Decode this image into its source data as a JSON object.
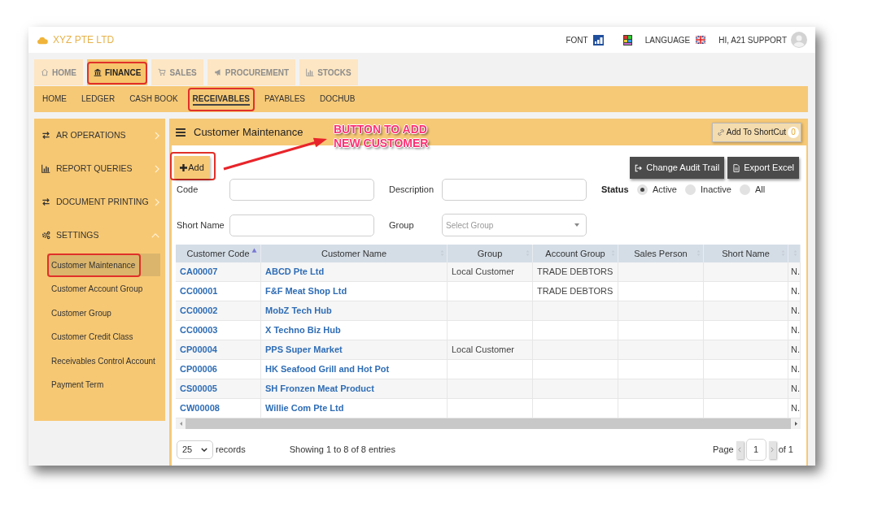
{
  "header": {
    "company": "XYZ PTE LTD",
    "font_label": "FONT",
    "language_label": "LANGUAGE",
    "greeting": "HI, A21 SUPPORT"
  },
  "main_tabs": [
    {
      "label": "HOME",
      "selected": false,
      "highlighted": false
    },
    {
      "label": "FINANCE",
      "selected": true,
      "highlighted": true
    },
    {
      "label": "SALES",
      "selected": false,
      "highlighted": false
    },
    {
      "label": "PROCUREMENT",
      "selected": false,
      "highlighted": false
    },
    {
      "label": "STOCKS",
      "selected": false,
      "highlighted": false
    }
  ],
  "sub_nav": [
    {
      "label": "HOME",
      "selected": false,
      "highlighted": false
    },
    {
      "label": "LEDGER",
      "selected": false,
      "highlighted": false
    },
    {
      "label": "CASH BOOK",
      "selected": false,
      "highlighted": false
    },
    {
      "label": "RECEIVABLES",
      "selected": true,
      "highlighted": true
    },
    {
      "label": "PAYABLES",
      "selected": false,
      "highlighted": false
    },
    {
      "label": "DOCHUB",
      "selected": false,
      "highlighted": false
    }
  ],
  "sidebar": {
    "sections": [
      {
        "label": "AR OPERATIONS",
        "expanded": false
      },
      {
        "label": "REPORT QUERIES",
        "expanded": false
      },
      {
        "label": "DOCUMENT PRINTING",
        "expanded": false
      },
      {
        "label": "SETTINGS",
        "expanded": true,
        "children": [
          {
            "label": "Customer Maintenance",
            "selected": true,
            "highlighted": true
          },
          {
            "label": "Customer Account Group",
            "selected": false,
            "highlighted": false
          },
          {
            "label": "Customer Group",
            "selected": false,
            "highlighted": false
          },
          {
            "label": "Customer Credit Class",
            "selected": false,
            "highlighted": false
          },
          {
            "label": "Receivables Control Account",
            "selected": false,
            "highlighted": false
          },
          {
            "label": "Payment Term",
            "selected": false,
            "highlighted": false
          }
        ]
      }
    ]
  },
  "page": {
    "title": "Customer Maintenance",
    "shortcut_button": "Add To ShortCut",
    "shortcut_count": "0"
  },
  "annotation": {
    "lines": [
      "BUTTON TO ADD",
      "NEW CUSTOMER"
    ]
  },
  "toolbar": {
    "add_button": {
      "label": "Add",
      "highlighted": true
    },
    "buttons": [
      "Change Audit Trail",
      "Export Excel"
    ]
  },
  "filters": {
    "fields": [
      {
        "label": "Code",
        "kind": "text"
      },
      {
        "label": "Description",
        "kind": "text"
      },
      {
        "label": "Short Name",
        "kind": "text"
      },
      {
        "label": "Group",
        "kind": "select",
        "placeholder": "Select Group"
      }
    ],
    "status": {
      "label": "Status",
      "options": [
        {
          "label": "Active",
          "selected": true
        },
        {
          "label": "Inactive",
          "selected": false
        },
        {
          "label": "All",
          "selected": false
        }
      ]
    }
  },
  "table": {
    "columns": [
      {
        "label": "Customer Code",
        "sorted": true
      },
      {
        "label": "Customer Name",
        "sorted": false
      },
      {
        "label": "Group",
        "sorted": false
      },
      {
        "label": "Account Group",
        "sorted": false
      },
      {
        "label": "Sales Person",
        "sorted": false
      },
      {
        "label": "Short Name",
        "sorted": false
      },
      {
        "sorted": false
      }
    ],
    "rows": [
      {
        "customer_code": "CA00007",
        "customer_name": "ABCD Pte Ltd",
        "group": "Local Customer",
        "account_group": "TRADE DEBTORS",
        "column_7": "N."
      },
      {
        "customer_code": "CC00001",
        "customer_name": "F&F Meat Shop Ltd",
        "account_group": "TRADE DEBTORS",
        "column_7": "N."
      },
      {
        "customer_code": "CC00002",
        "customer_name": "MobZ Tech Hub",
        "column_7": "N."
      },
      {
        "customer_code": "CC00003",
        "customer_name": "X Techno Biz Hub",
        "column_7": "N."
      },
      {
        "customer_code": "CP00004",
        "customer_name": "PPS Super Market",
        "group": "Local Customer",
        "column_7": "N."
      },
      {
        "customer_code": "CP00006",
        "customer_name": "HK Seafood Grill and Hot Pot",
        "column_7": "N."
      },
      {
        "customer_code": "CS00005",
        "customer_name": "SH Fronzen Meat Product",
        "column_7": "N."
      },
      {
        "customer_code": "CW00008",
        "customer_name": "Willie Com Pte Ltd",
        "column_7": "N."
      }
    ]
  },
  "footer": {
    "page_size": "25",
    "records_label": "records",
    "summary": "Showing 1 to 8 of 8 entries",
    "page_label": "Page",
    "page": "1",
    "page_total": "of 1"
  }
}
